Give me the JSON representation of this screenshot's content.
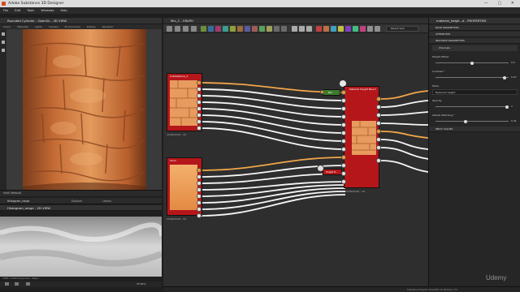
{
  "app": {
    "title": "Adobe Substance 3D Designer",
    "window_controls": "— ▢ ✕"
  },
  "menu": [
    "File",
    "Edit",
    "Tools",
    "Windows",
    "Help"
  ],
  "view3d": {
    "title": "Rounded Cylinder - OpenGL - 3D VIEW",
    "toolbar": [
      "Scene",
      "Materials",
      "Lights",
      "Camera",
      "Environment",
      "Display",
      "Renderer"
    ],
    "shelf_tab": "shelf (default)"
  },
  "lower_tabs": [
    "Histogram_range",
    "Explorer",
    "Library"
  ],
  "view2d": {
    "title": "Histogram_range - 2D VIEW",
    "footer": "2048 x 2048 (Grayscale, 16bpc)",
    "zoom": "35.02%"
  },
  "graph": {
    "tab": "Mix_2 - GRAPH",
    "dropdown": "Parent Size",
    "nodes": {
      "n1": {
        "title": "Cobblestone_3",
        "caption": "2048x2048 - C8"
      },
      "n2": {
        "title": "Sand",
        "caption": "2048x2048 - C8"
      },
      "n3": {
        "title": "Material Height Blend",
        "caption": "2048x2048 - C8"
      },
      "n4": {
        "title": "Mix"
      },
      "n5": {
        "title": "Height R..."
      }
    }
  },
  "properties": {
    "title": "material_heigh...d - PROPERTIES",
    "sections": {
      "base": "BASE PARAMETERS",
      "attributes": "ATTRIBUTES",
      "instance": "INSTANCE PARAMETERS",
      "channels": "Channels",
      "input": "INPUT VALUES"
    },
    "params": {
      "height_offset": {
        "label": "Height Offset",
        "value": "0.5",
        "fill": 0.5
      },
      "contrast": {
        "label": "Contrast *",
        "value": "0.97",
        "fill": 0.97
      },
      "mode": {
        "label": "Mode",
        "value": "Balanced height"
      },
      "opacity": {
        "label": "Opacity",
        "value": "1",
        "fill": 1.0
      },
      "albedo": {
        "label": "Albedo Matching *",
        "value": "0.41",
        "fill": 0.41
      }
    }
  },
  "statusbar": {
    "engine": "Substance Engine: Direct3D 11 Memory: 2%"
  },
  "watermark": "Udemy",
  "colors": {
    "node_red": "#b5161a",
    "node_green": "#3f7a2d",
    "wire_orange": "#f2a54a",
    "accent": "#f0a030",
    "logo": "#d84a1b"
  }
}
